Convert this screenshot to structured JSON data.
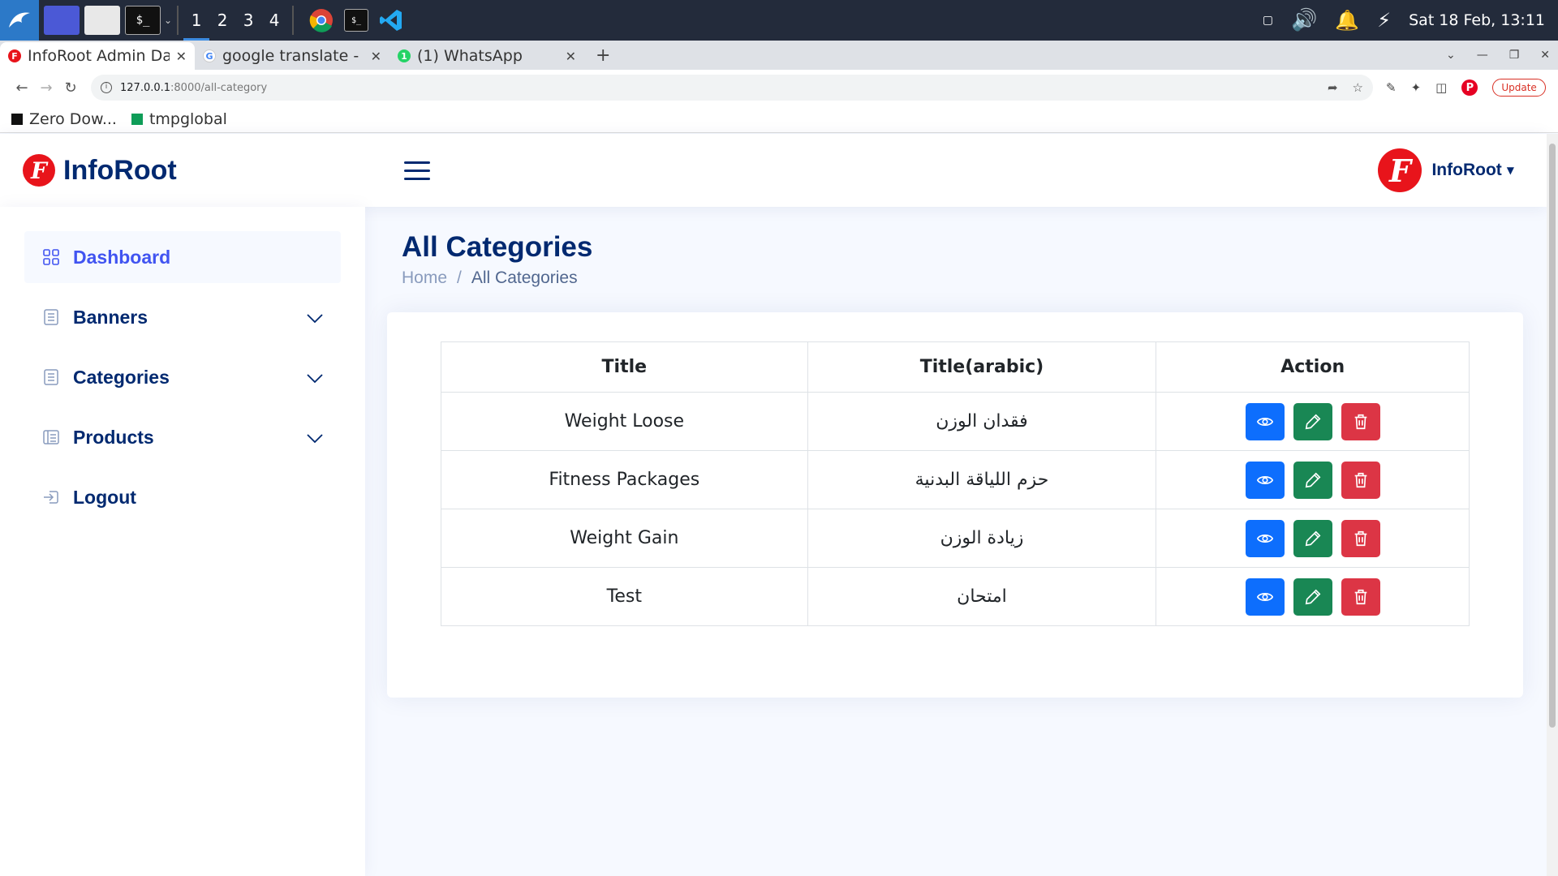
{
  "taskbar": {
    "workspaces": [
      "1",
      "2",
      "3",
      "4"
    ],
    "terminal_label": "$_",
    "clock": "Sat 18 Feb, 13:11"
  },
  "browser": {
    "tabs": [
      {
        "title": "InfoRoot Admin Da",
        "favicon_color": "#e8141b",
        "favicon": "F"
      },
      {
        "title": "google translate -",
        "favicon_color": "#4285f4",
        "favicon": "G"
      },
      {
        "title": "(1) WhatsApp",
        "favicon_color": "#25d366",
        "favicon": "1"
      }
    ],
    "new_tab": "+",
    "url_host": "127.0.0.1",
    "url_path": ":8000/all-category",
    "update_label": "Update",
    "bookmarks": [
      "Zero Dow...",
      "tmpglobal"
    ]
  },
  "app": {
    "logo_text": "InfoRoot",
    "logo_badge": "F",
    "profile_name": "InfoRoot",
    "sidebar": [
      {
        "label": "Dashboard",
        "icon": "grid-icon"
      },
      {
        "label": "Banners",
        "icon": "document-icon"
      },
      {
        "label": "Categories",
        "icon": "document-icon"
      },
      {
        "label": "Products",
        "icon": "layout-icon"
      },
      {
        "label": "Logout",
        "icon": "logout-icon"
      }
    ],
    "page_title": "All Categories",
    "breadcrumb": {
      "home": "Home",
      "separator": "/",
      "current": "All Categories"
    },
    "table": {
      "headers": [
        "Title",
        "Title(arabic)",
        "Action"
      ],
      "rows": [
        {
          "title": "Weight Loose",
          "title_ar": "فقدان الوزن"
        },
        {
          "title": "Fitness Packages",
          "title_ar": "حزم اللياقة البدنية"
        },
        {
          "title": "Weight Gain",
          "title_ar": "زيادة الوزن"
        },
        {
          "title": "Test",
          "title_ar": "امتحان"
        }
      ]
    }
  },
  "colors": {
    "brand_red": "#e8141b",
    "navy": "#012970",
    "accent": "#4154f1",
    "view": "#0d6efd",
    "edit": "#198754",
    "delete": "#dc3545"
  }
}
